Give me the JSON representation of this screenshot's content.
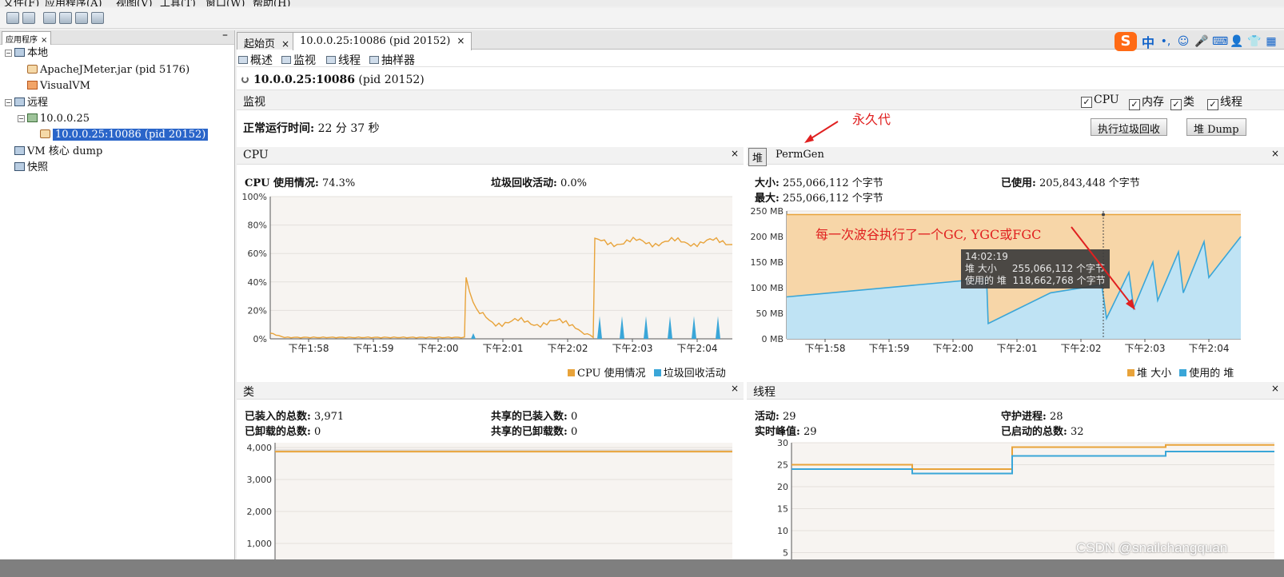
{
  "menubar": {
    "items": [
      "文件(F)",
      "应用程序(A)",
      "视图(V)",
      "工具(T)",
      "窗口(W)",
      "帮助(H)"
    ]
  },
  "left_panel": {
    "tab_label": "应用程序",
    "tree": {
      "local": "本地",
      "jmeter": "ApacheJMeter.jar (pid 5176)",
      "visualvm": "VisualVM",
      "remote": "远程",
      "host": "10.0.0.25",
      "process": "10.0.0.25:10086 (pid 20152)",
      "vm_dump": "VM 核心 dump",
      "snapshot": "快照"
    }
  },
  "doc_tabs": {
    "start": "起始页",
    "process": "10.0.0.25:10086 (pid 20152)"
  },
  "sub_tabs": [
    "概述",
    "监视",
    "线程",
    "抽样器"
  ],
  "process_title": {
    "name": "10.0.0.25:10086",
    "pid": "(pid 20152)"
  },
  "monitor": {
    "title": "监视",
    "checkboxes": [
      "CPU",
      "内存",
      "类",
      "线程"
    ],
    "uptime_label": "正常运行时间:",
    "uptime_value": "22 分 37 秒",
    "gc_button": "执行垃圾回收",
    "heap_dump_button": "堆 Dump"
  },
  "annotations": {
    "permgen": "永久代",
    "gc_note": "每一次波谷执行了一个GC, YGC或FGC"
  },
  "colors": {
    "orange": "#e8a33a",
    "blue": "#3aa6d8",
    "orange_fill": "#f7d6a8",
    "blue_fill": "#bfe3f4",
    "annotation": "#e02020"
  },
  "time_ticks": [
    "下午1:58",
    "下午1:59",
    "下午2:00",
    "下午2:01",
    "下午2:02",
    "下午2:03",
    "下午2:04"
  ],
  "cpu_panel": {
    "title": "CPU",
    "usage_label": "CPU 使用情况:",
    "usage_value": "74.3%",
    "gc_label": "垃圾回收活动:",
    "gc_value": "0.0%",
    "y_ticks": [
      "100%",
      "80%",
      "60%",
      "40%",
      "20%",
      "0%"
    ],
    "legend": [
      "CPU 使用情况",
      "垃圾回收活动"
    ]
  },
  "heap_panel": {
    "tab_heap": "堆",
    "tab_permgen": "PermGen",
    "size_label": "大小:",
    "size_value": "255,066,112 个字节",
    "used_label": "已使用:",
    "used_value": "205,843,448 个字节",
    "max_label": "最大:",
    "max_value": "255,066,112 个字节",
    "y_ticks": [
      "250 MB",
      "200 MB",
      "150 MB",
      "100 MB",
      "50 MB",
      "0 MB"
    ],
    "legend": [
      "堆 大小",
      "使用的 堆"
    ],
    "tooltip": {
      "time": "14:02:19",
      "line1": "堆 大小     255,066,112 个字节",
      "line2": "使用的 堆  118,662,768 个字节"
    }
  },
  "classes_panel": {
    "title": "类",
    "loaded_label": "已装入的总数:",
    "loaded_value": "3,971",
    "unloaded_label": "已卸载的总数:",
    "unloaded_value": "0",
    "shared_loaded_label": "共享的已装入数:",
    "shared_loaded_value": "0",
    "shared_unloaded_label": "共享的已卸载数:",
    "shared_unloaded_value": "0",
    "y_ticks": [
      "4,000",
      "3,000",
      "2,000",
      "1,000"
    ]
  },
  "threads_panel": {
    "title": "线程",
    "live_label": "活动:",
    "live_value": "29",
    "peak_label": "实时峰值:",
    "peak_value": "29",
    "daemon_label": "守护进程:",
    "daemon_value": "28",
    "started_label": "已启动的总数:",
    "started_value": "32",
    "y_ticks": [
      "30",
      "25",
      "20",
      "15",
      "10",
      "5"
    ]
  },
  "watermark": "CSDN @snailchangquan",
  "chart_data": [
    {
      "type": "line",
      "title": "CPU",
      "x": [
        "下午1:58",
        "下午1:59",
        "下午2:00",
        "下午2:01",
        "下午2:02",
        "下午2:03",
        "下午2:04"
      ],
      "series": [
        {
          "name": "CPU 使用情况",
          "values": [
            1,
            1,
            1,
            15,
            11,
            68,
            70
          ]
        },
        {
          "name": "垃圾回收活动",
          "values": [
            0,
            0,
            0,
            0,
            0,
            15,
            15
          ]
        }
      ],
      "ylim": [
        0,
        100
      ]
    },
    {
      "type": "area",
      "title": "堆",
      "x": [
        "下午1:58",
        "下午1:59",
        "下午2:00",
        "下午2:01",
        "下午2:02",
        "下午2:03",
        "下午2:04"
      ],
      "series": [
        {
          "name": "堆 大小",
          "values": [
            243,
            243,
            243,
            243,
            243,
            243,
            243
          ]
        },
        {
          "name": "使用的 堆",
          "values": [
            90,
            105,
            118,
            60,
            100,
            80,
            150
          ]
        }
      ],
      "ylim": [
        0,
        250
      ]
    },
    {
      "type": "line",
      "title": "类",
      "series": [
        {
          "name": "已装入的总数",
          "values": [
            3971,
            3971,
            3971,
            3971,
            3971,
            3971,
            3971
          ]
        }
      ],
      "ylim": [
        0,
        4500
      ]
    },
    {
      "type": "line",
      "title": "线程",
      "series": [
        {
          "name": "实时峰值",
          "values": [
            25,
            25,
            24,
            29,
            29,
            29,
            29
          ]
        },
        {
          "name": "活动",
          "values": [
            24,
            24,
            23,
            27,
            27,
            28,
            28
          ]
        }
      ],
      "ylim": [
        0,
        30
      ]
    }
  ]
}
